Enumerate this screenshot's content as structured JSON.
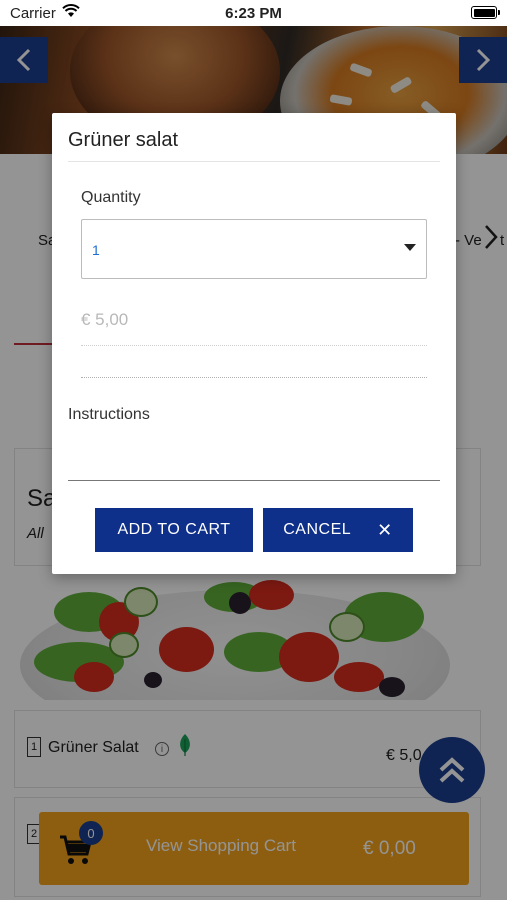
{
  "status_bar": {
    "carrier": "Carrier",
    "time": "6:23 PM"
  },
  "hero": {
    "prev_label": "‹",
    "next_label": "›"
  },
  "categories": {
    "first_partial": "Sa",
    "last_partial": "- Ve",
    "next_partial": "t"
  },
  "section": {
    "title_partial": "Sa",
    "subtitle_partial": "All"
  },
  "menu_items": [
    {
      "qty": "1",
      "name": "Grüner Salat",
      "price_partial": "€ 5,0"
    },
    {
      "qty": "2"
    }
  ],
  "cart": {
    "count": "0",
    "label": "View Shopping Cart",
    "total": "€ 0,00"
  },
  "modal": {
    "title": "Grüner salat",
    "quantity_label": "Quantity",
    "quantity_value": "1",
    "price": "€ 5,00",
    "instructions_label": "Instructions",
    "instructions_value": "",
    "add_button": "ADD TO CART",
    "cancel_button": "CANCEL"
  },
  "colors": {
    "primary": "#0e2f8a",
    "nav": "#1b3f8f",
    "cart": "#f3a31b",
    "accent_red": "#c2303a",
    "link_blue": "#1e6fd1"
  }
}
